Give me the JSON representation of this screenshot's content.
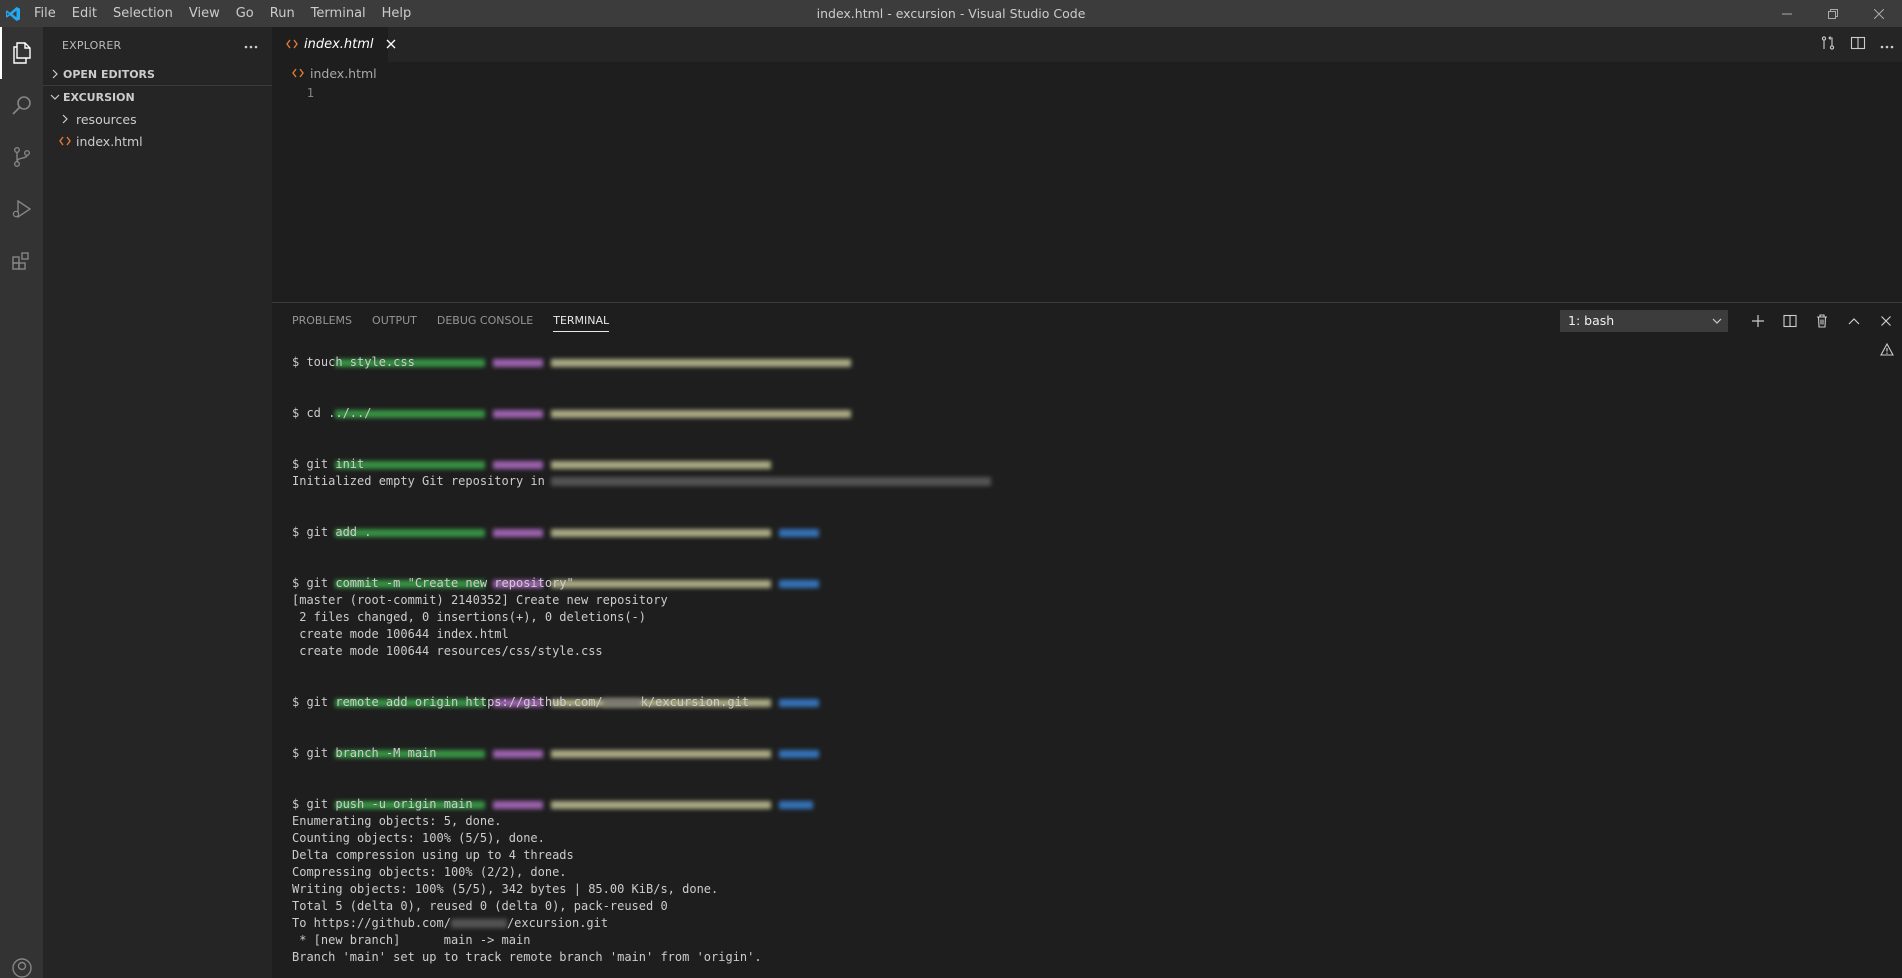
{
  "titlebar": {
    "menu": [
      "File",
      "Edit",
      "Selection",
      "View",
      "Go",
      "Run",
      "Terminal",
      "Help"
    ],
    "title": "index.html - excursion - Visual Studio Code"
  },
  "activitybar": {
    "icons": [
      "explorer-icon",
      "search-icon",
      "source-control-icon",
      "run-debug-icon",
      "extensions-icon",
      "account-icon"
    ]
  },
  "sidebar": {
    "title": "EXPLORER",
    "more_icon": "ellipsis-icon",
    "open_editors_label": "OPEN EDITORS",
    "workspace_label": "EXCURSION",
    "tree": [
      {
        "label": "resources",
        "type": "folder"
      },
      {
        "label": "index.html",
        "type": "file"
      }
    ]
  },
  "editor": {
    "tab_label": "index.html",
    "breadcrumb": "index.html",
    "line_number": "1"
  },
  "panel": {
    "tabs": [
      "PROBLEMS",
      "OUTPUT",
      "DEBUG CONSOLE",
      "TERMINAL"
    ],
    "active_tab": "TERMINAL",
    "terminal_select": "1: bash"
  },
  "terminal": {
    "lines": [
      "$ touch style.css",
      "$ cd ../../",
      "$ git init",
      "Initialized empty Git repository in",
      "$ git add .",
      "$ git commit -m \"Create new repository\"",
      "[master (root-commit) 2140352] Create new repository",
      " 2 files changed, 0 insertions(+), 0 deletions(-)",
      " create mode 100644 index.html",
      " create mode 100644 resources/css/style.css",
      "$ git remote add origin https://github.com/",
      "k/excursion.git",
      "$ git branch -M main",
      "$ git push -u origin main",
      "Enumerating objects: 5, done.",
      "Counting objects: 100% (5/5), done.",
      "Delta compression using up to 4 threads",
      "Compressing objects: 100% (2/2), done.",
      "Writing objects: 100% (5/5), 342 bytes | 85.00 KiB/s, done.",
      "Total 5 (delta 0), reused 0 (delta 0), pack-reused 0",
      "To https://github.com/",
      "/excursion.git",
      " * [new branch]      main -> main",
      "Branch 'main' set up to track remote branch 'main' from 'origin'."
    ]
  },
  "colors": {
    "accent": "#007acc",
    "html_icon": "#e37933",
    "prompt_green": "#3fb950",
    "prompt_magenta": "#c678dd",
    "prompt_yellow": "#d7d7a5",
    "prompt_cyan": "#3b8eea"
  }
}
